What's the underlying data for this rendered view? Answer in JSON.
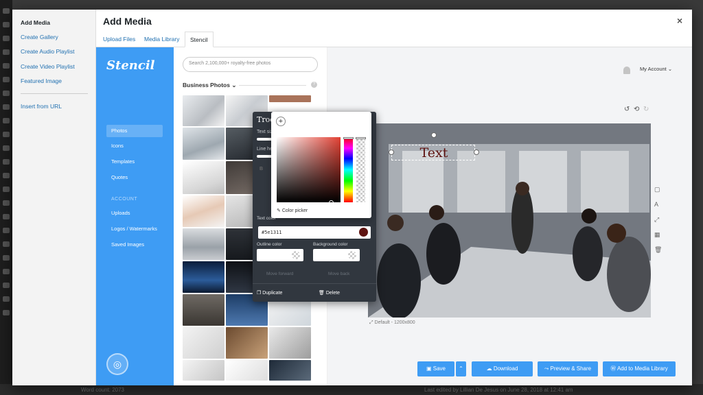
{
  "modal": {
    "title": "Add Media",
    "close": "×"
  },
  "menu": {
    "items": [
      "Add Media",
      "Create Gallery",
      "Create Audio Playlist",
      "Create Video Playlist",
      "Featured Image"
    ],
    "insert_url": "Insert from URL"
  },
  "tabs": [
    "Upload Files",
    "Media Library",
    "Stencil"
  ],
  "stencil": {
    "logo": "Stencil",
    "nav": [
      "Photos",
      "Icons",
      "Templates",
      "Quotes"
    ],
    "account_heading": "ACCOUNT",
    "account_nav": [
      "Uploads",
      "Logos / Watermarks",
      "Saved Images"
    ]
  },
  "browser": {
    "search_placeholder": "Search 2,100,000+ royalty-free photos",
    "category": "Business Photos",
    "chevron": "⌄",
    "help": "?"
  },
  "editor": {
    "account": "My Account",
    "account_chevron": "⌄",
    "canvas_text": "Text",
    "canvas_text_color": "#5e1311",
    "dimensions": "Default - 1200x800",
    "undo_icons": [
      "↺",
      "⟲",
      "↻"
    ],
    "side_tools": [
      "▢",
      "A",
      "⤢",
      "▦",
      "🗑"
    ]
  },
  "popover": {
    "font_value": "Troc",
    "text_size_label": "Text siz",
    "line_height_label": "Line he",
    "color_picker_label": "Color picker",
    "text_color_label": "Text color",
    "hex_value": "#5e1311",
    "outline_label": "Outline color",
    "background_label": "Background color",
    "move_forward": "Move forward",
    "move_back": "Move back",
    "duplicate": "Duplicate",
    "delete": "Delete",
    "plus": "+"
  },
  "buttons": {
    "save": "Save",
    "download": "Download",
    "preview_share": "Preview & Share",
    "add_to_library": "Add to Media Library"
  },
  "footer": {
    "word_count": "Word count: 2073",
    "last_edited": "Last edited by Lillian De Jesus on June 28, 2018 at 12:41 am"
  },
  "colors": {
    "accent": "#3e9cf4",
    "link": "#2271b1",
    "popover": "#31373f"
  }
}
